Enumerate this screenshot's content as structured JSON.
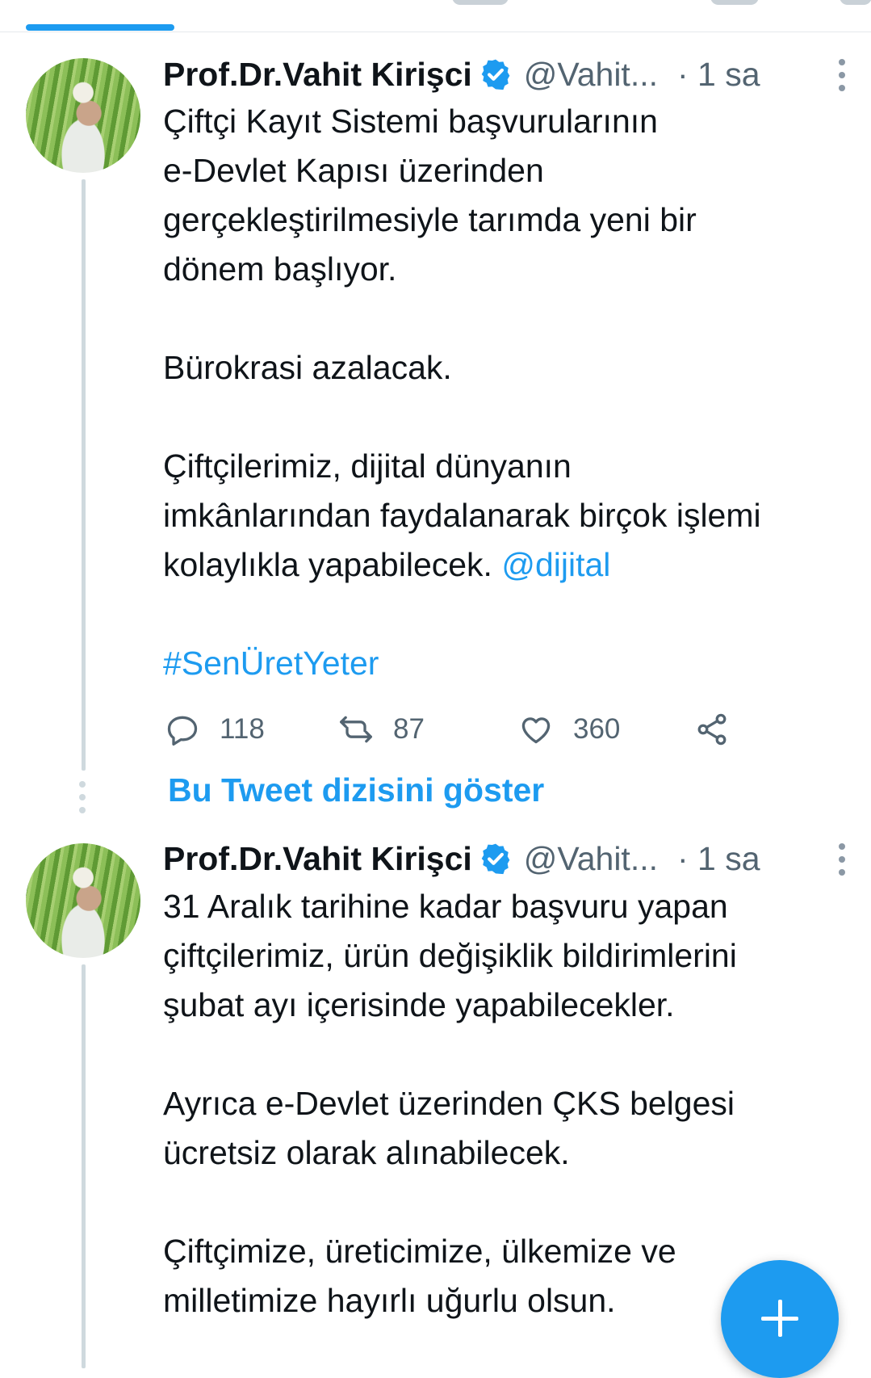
{
  "tweets": [
    {
      "author_name": "Prof.Dr.Vahit Kirişci",
      "handle": "@Vahit...",
      "time": "· 1 sa",
      "text_lines": [
        "Çiftçi Kayıt Sistemi başvurularının",
        "e-Devlet Kapısı üzerinden",
        "gerçekleştirilmesiyle tarımda yeni bir",
        "dönem başlıyor."
      ],
      "text2": "Bürokrasi azalacak.",
      "text3_lines": [
        "Çiftçilerimiz, dijital dünyanın",
        "imkânlarından faydalanarak birçok işlemi"
      ],
      "text3_last": "kolaylıkla yapabilecek.",
      "mention": "@dijital",
      "hashtag": "#SenÜretYeter",
      "replies": "118",
      "retweets": "87",
      "likes": "360"
    },
    {
      "author_name": "Prof.Dr.Vahit Kirişci",
      "handle": "@Vahit...",
      "time": "· 1 sa",
      "text_lines": [
        "31 Aralık tarihine kadar başvuru yapan",
        "çiftçilerimiz, ürün değişiklik bildirimlerini",
        "şubat ayı içerisinde yapabilecekler."
      ],
      "text2_lines": [
        "Ayrıca e-Devlet üzerinden ÇKS belgesi",
        "ücretsiz olarak alınabilecek."
      ],
      "text3_lines": [
        "Çiftçimize, üreticimize, ülkemize ve",
        "milletimize hayırlı uğurlu olsun."
      ]
    }
  ],
  "show_thread": "Bu Tweet dizisini göster",
  "icons": {
    "verified": "verified-badge-icon",
    "reply": "reply-icon",
    "retweet": "retweet-icon",
    "like": "heart-icon",
    "share": "share-icon",
    "more": "more-options-icon",
    "compose": "plus-icon"
  },
  "colors": {
    "accent": "#1d9bf0",
    "text": "#0f1419",
    "secondary": "#536471"
  }
}
